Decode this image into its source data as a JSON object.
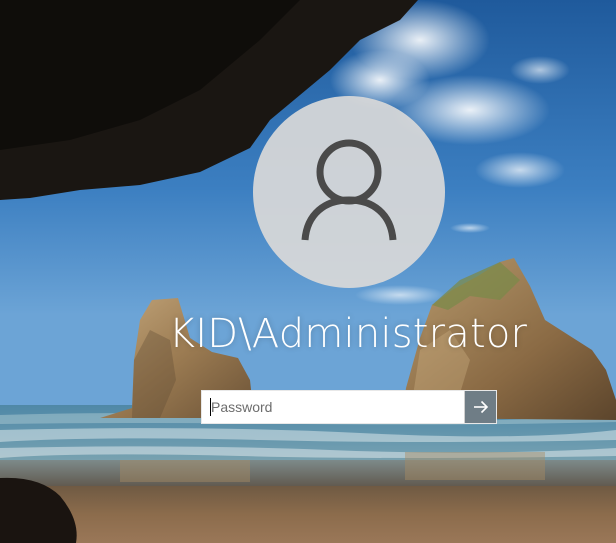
{
  "user": {
    "display_name": "KID\\Administrator",
    "avatar_icon": "user-silhouette-icon"
  },
  "password": {
    "placeholder": "Password",
    "value": ""
  },
  "submit": {
    "icon": "arrow-right-icon"
  },
  "colors": {
    "avatar_circle": "#d8d8d8",
    "avatar_figure": "#4a4a4a",
    "text": "#ffffff",
    "submit_button": "#6f7d86"
  }
}
